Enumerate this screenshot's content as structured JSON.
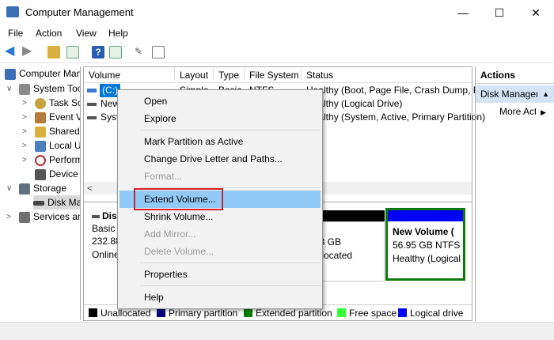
{
  "window": {
    "title": "Computer Management"
  },
  "menubar": [
    "File",
    "Action",
    "View",
    "Help"
  ],
  "tree": [
    {
      "label": "Computer Management (Local)",
      "color": "#3a6fb5"
    },
    {
      "label": "System Tools",
      "color": "#8a8a8a"
    },
    {
      "label": "Task Scheduler",
      "color": "#c9a040"
    },
    {
      "label": "Event Viewer",
      "color": "#b57a3a"
    },
    {
      "label": "Shared Folders",
      "color": "#d9b040"
    },
    {
      "label": "Local Users and Groups",
      "color": "#4a7fc0"
    },
    {
      "label": "Performance",
      "color": "#b03030"
    },
    {
      "label": "Device Manager",
      "color": "#555555"
    },
    {
      "label": "Storage",
      "color": "#607080"
    },
    {
      "label": "Disk Management",
      "color": "#444444"
    },
    {
      "label": "Services and Applications",
      "color": "#707070"
    }
  ],
  "volumes": {
    "headers": [
      "Volume",
      "Layout",
      "Type",
      "File System",
      "Status"
    ],
    "rows": [
      [
        "(C:)",
        "Simple",
        "Basic",
        "NTFS",
        "Healthy (Boot, Page File, Crash Dump, Primary Partition)"
      ],
      [
        "New Volume",
        "",
        "",
        "",
        "Healthy (Logical Drive)"
      ],
      [
        "System Reserved",
        "",
        "",
        "",
        "Healthy (System, Active, Primary Partition)"
      ]
    ]
  },
  "disk": {
    "name": "Disk 0",
    "type": "Basic",
    "size": "232.88 GB",
    "state": "Online",
    "unalloc_size": "23 GB",
    "unalloc_label": "allocated",
    "newvol": {
      "name": "New Volume (",
      "size": "56.95 GB NTFS",
      "status": "Healthy (Logical"
    }
  },
  "legend": [
    {
      "label": "Unallocated",
      "color": "#000000"
    },
    {
      "label": "Primary partition",
      "color": "#00007f"
    },
    {
      "label": "Extended partition",
      "color": "#007f00"
    },
    {
      "label": "Free space",
      "color": "#33ff33"
    },
    {
      "label": "Logical drive",
      "color": "#0000ff"
    }
  ],
  "actions": {
    "title": "Actions",
    "section": "Disk Management",
    "more": "More Actions"
  },
  "context_menu": [
    {
      "label": "Open",
      "enabled": true
    },
    {
      "label": "Explore",
      "enabled": true
    },
    {
      "label": "Mark Partition as Active",
      "enabled": true
    },
    {
      "label": "Change Drive Letter and Paths...",
      "enabled": true
    },
    {
      "label": "Format...",
      "enabled": false
    },
    {
      "label": "Extend Volume...",
      "enabled": true,
      "highlighted": true
    },
    {
      "label": "Shrink Volume...",
      "enabled": true
    },
    {
      "label": "Add Mirror...",
      "enabled": false
    },
    {
      "label": "Delete Volume...",
      "enabled": false
    },
    {
      "label": "Properties",
      "enabled": true
    },
    {
      "label": "Help",
      "enabled": true
    }
  ]
}
